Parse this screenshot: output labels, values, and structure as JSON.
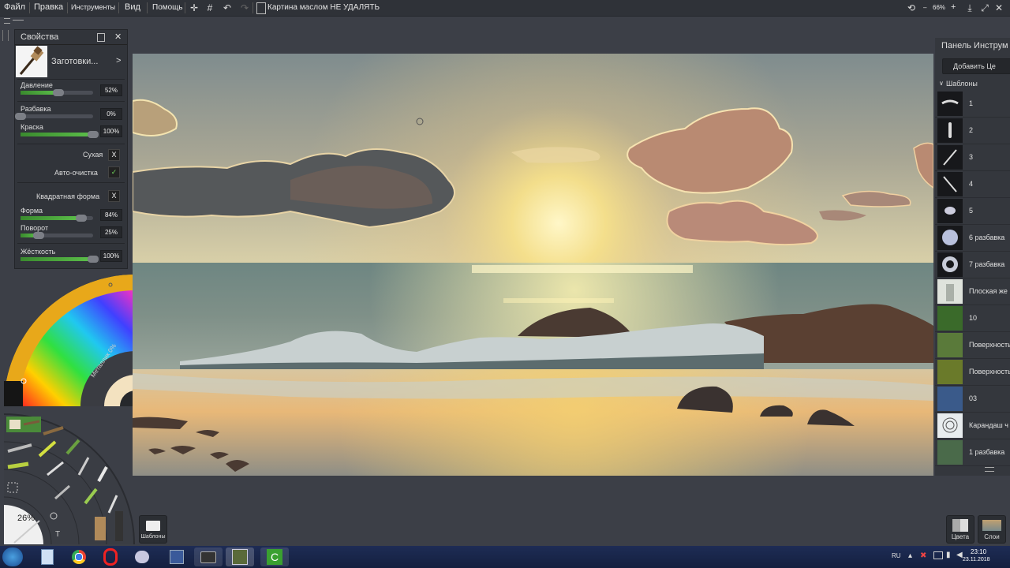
{
  "menu": {
    "file": "Файл",
    "edit": "Правка",
    "tools": "Инструменты",
    "view": "Вид",
    "help": "Помощь",
    "document_title": "Картина маслом НЕ УДАЛЯТЬ",
    "zoom": "66%"
  },
  "properties": {
    "title": "Свойства",
    "preset_label": "Заготовки...",
    "pressure_label": "Давление",
    "pressure_value": "52%",
    "pressure": 0.52,
    "thinning_label": "Разбавка",
    "thinning_value": "0%",
    "thinning": 0.0,
    "paint_label": "Краска",
    "paint_value": "100%",
    "paint": 1.0,
    "dry_label": "Сухая",
    "dry_mark": "X",
    "autoclean_label": "Авто-очистка",
    "autoclean_mark": "✓",
    "square_label": "Квадратная форма",
    "square_mark": "X",
    "shape_label": "Форма",
    "shape_value": "84%",
    "shape": 0.84,
    "rotation_label": "Поворот",
    "rotation_value": "25%",
    "rotation": 0.25,
    "hardness_label": "Жёсткость",
    "hardness_value": "100%",
    "hardness": 1.0
  },
  "color_wheel": {
    "metallic_label": "Металлик 0%"
  },
  "tool_wheel": {
    "size_value": "26%"
  },
  "templates_button": "Шаблоны",
  "tool_panel": {
    "title": "Панель Инструм",
    "add_button": "Добавить Це",
    "section_label": "Шаблоны",
    "items": [
      {
        "label": "1"
      },
      {
        "label": "2"
      },
      {
        "label": "3"
      },
      {
        "label": "4"
      },
      {
        "label": "5"
      },
      {
        "label": "6 разбавка"
      },
      {
        "label": "7 разбавка"
      },
      {
        "label": "Плоская же"
      },
      {
        "label": "10"
      },
      {
        "label": "Поверхность"
      },
      {
        "label": "Поверхность"
      },
      {
        "label": "03"
      },
      {
        "label": "Карандаш ч"
      },
      {
        "label": "1 разбавка"
      }
    ]
  },
  "bottom_right": {
    "colors_label": "Цвета",
    "layers_label": "Слои"
  },
  "taskbar": {
    "lang": "RU",
    "time": "23:10",
    "date": "23.11.2018"
  }
}
